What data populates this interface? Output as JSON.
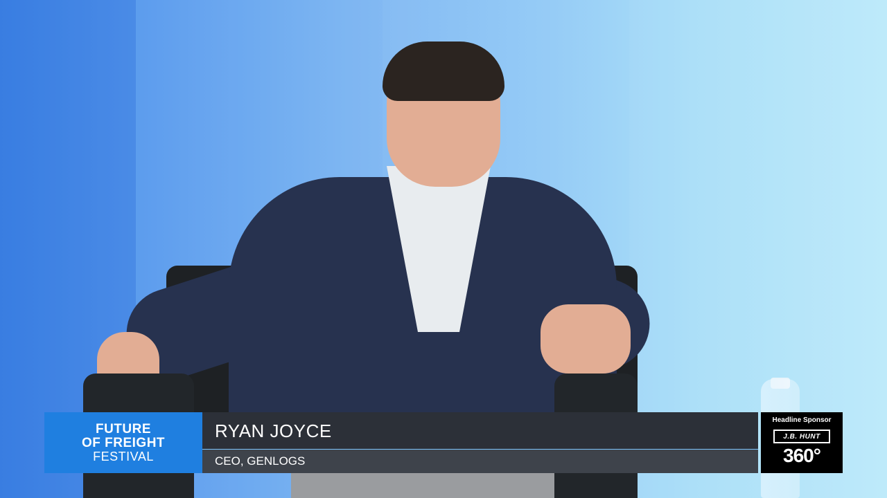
{
  "lower_third": {
    "brand": {
      "line1": "FUTURE",
      "line2": "OF FREIGHT",
      "line3": "FESTIVAL"
    },
    "speaker_name": "RYAN JOYCE",
    "speaker_title": "CEO, GENLOGS"
  },
  "sponsor": {
    "label": "Headline Sponsor",
    "logo_text": "J.B. HUNT",
    "product": "360°"
  },
  "colors": {
    "brand_blue": "#1f7fe0",
    "name_bar": "#2c3038",
    "title_bar": "#3e434b",
    "accent_line": "#7ec6ff"
  }
}
